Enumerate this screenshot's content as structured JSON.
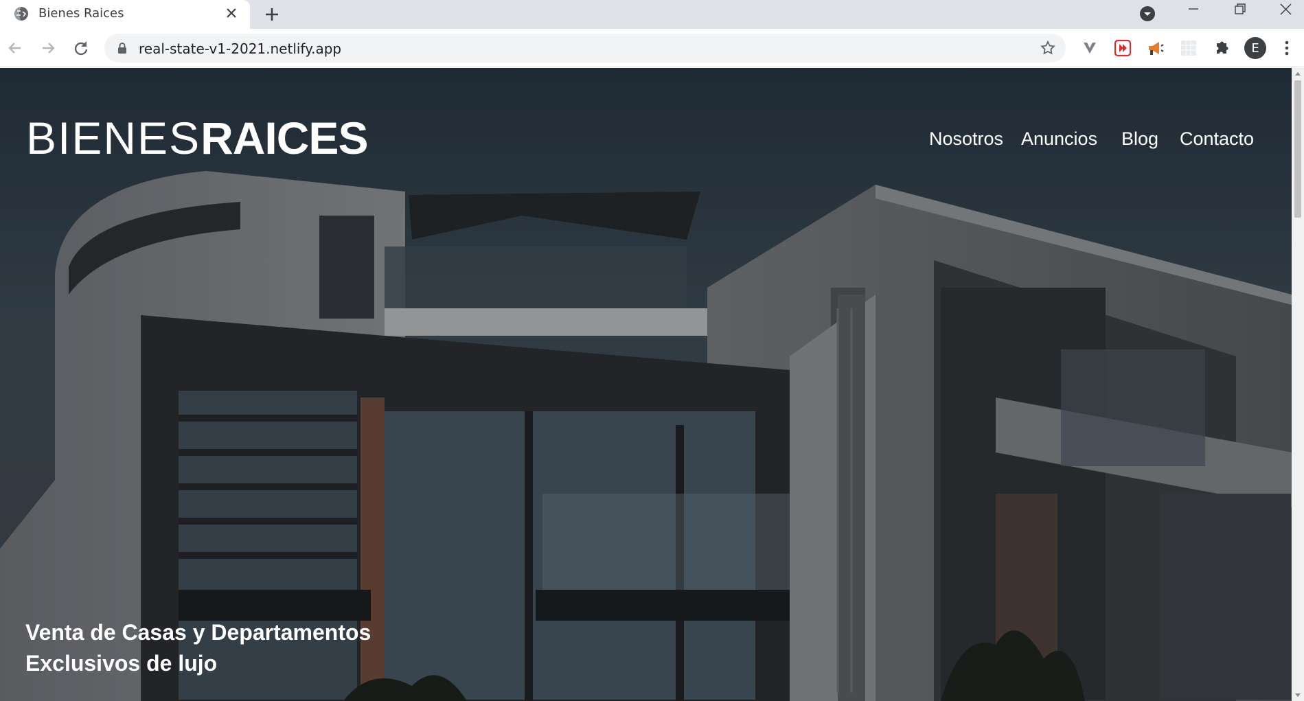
{
  "browser": {
    "tab_title": "Bienes Raices",
    "url": "real-state-v1-2021.netlify.app",
    "avatar_letter": "E",
    "icons": {
      "favicon": "globe-icon",
      "close_tab": "close-icon",
      "new_tab": "plus-icon",
      "tab_search": "chevron-down-icon",
      "back": "arrow-left-icon",
      "forward": "arrow-right-icon",
      "reload": "reload-icon",
      "lock": "lock-icon",
      "bookmark": "star-icon",
      "menu": "more-vert-icon"
    }
  },
  "header": {
    "logo_light": "BIENES",
    "logo_bold": "RAICES",
    "nav": [
      "Nosotros",
      "Anuncios",
      "Blog",
      "Contacto"
    ]
  },
  "hero": {
    "tagline_line1": "Venta de Casas y Departamentos",
    "tagline_line2": "Exclusivos de lujo"
  },
  "colors": {
    "hero_overlay": "#2d3b47",
    "text": "#ffffff",
    "tab_bar": "#dee1e6",
    "omnibox": "#f1f3f4"
  }
}
